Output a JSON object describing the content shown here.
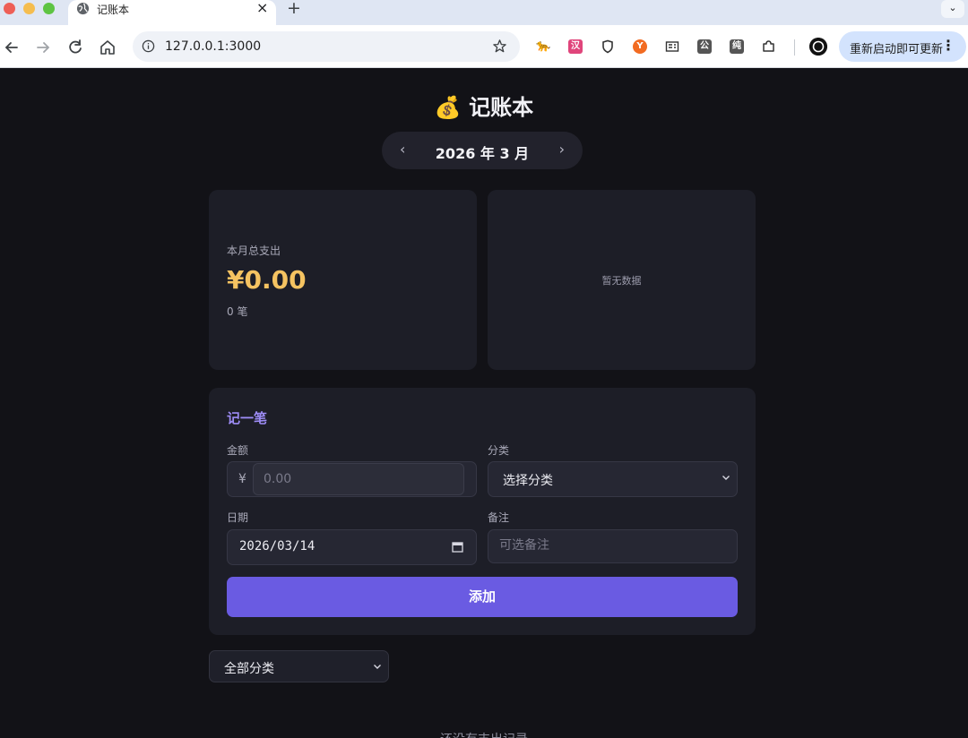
{
  "browser": {
    "tab_title": "记账本",
    "url": "127.0.0.1:3000",
    "update_button_label": "重新启动即可更新",
    "extensions": [
      {
        "name": "puzzle-ext-icon",
        "glyph": "",
        "color": "#e2b02c"
      },
      {
        "name": "translate-ext-icon",
        "glyph": "汉",
        "color": "#e0457b"
      },
      {
        "name": "shield-ext-icon",
        "glyph": "",
        "color": "#444444"
      },
      {
        "name": "y-ext-icon",
        "glyph": "Y",
        "color": "#f26b21"
      },
      {
        "name": "reader-ext-icon",
        "glyph": "",
        "color": "#444444"
      },
      {
        "name": "gong-ext-icon",
        "glyph": "公",
        "color": "#555555"
      },
      {
        "name": "chun-ext-icon",
        "glyph": "纯",
        "color": "#555555"
      }
    ]
  },
  "app": {
    "title": "💰 记账本",
    "month_label": "2026 年 3 月",
    "prev_arrow": "‹",
    "next_arrow": "›"
  },
  "summary": {
    "caption": "本月总支出",
    "amount": "¥0.00",
    "count": "0 笔"
  },
  "chart": {
    "empty_text": "暂无数据"
  },
  "form": {
    "title": "记一笔",
    "amount_label": "金额",
    "amount_prefix": "¥",
    "amount_placeholder": "0.00",
    "category_label": "分类",
    "category_value": "选择分类",
    "date_label": "日期",
    "date_value": "2026/03/14",
    "note_label": "备注",
    "note_placeholder": "可选备注",
    "submit_label": "添加"
  },
  "filter": {
    "value": "全部分类"
  },
  "list": {
    "empty_text": "还没有支出记录"
  },
  "colors": {
    "accent": "#6a5be2",
    "amount": "#f5c361",
    "background": "#121217",
    "card": "#1d1e27"
  }
}
